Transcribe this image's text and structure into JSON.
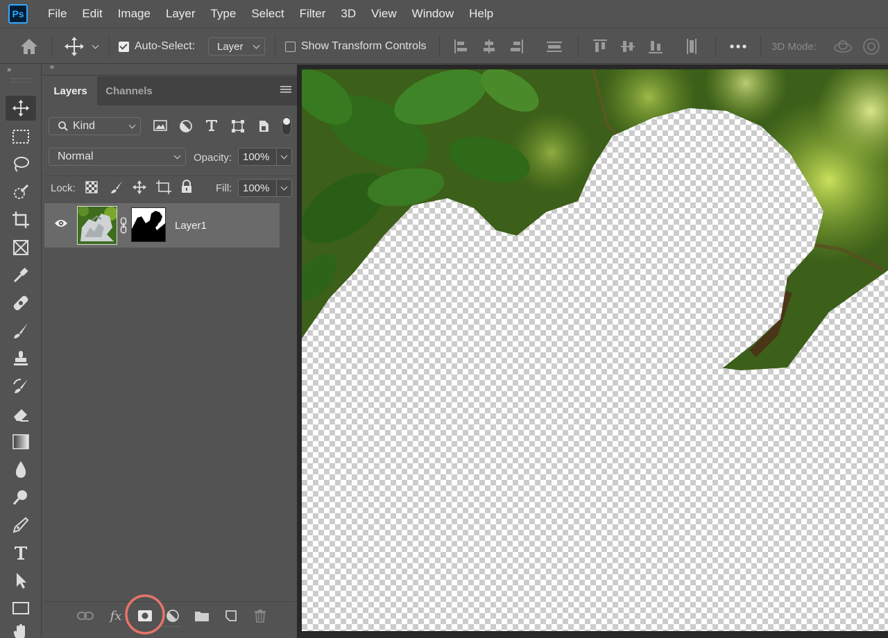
{
  "app": {
    "logo_text": "Ps"
  },
  "menu": [
    "File",
    "Edit",
    "Image",
    "Layer",
    "Type",
    "Select",
    "Filter",
    "3D",
    "View",
    "Window",
    "Help"
  ],
  "options_bar": {
    "auto_select_label": "Auto-Select:",
    "auto_select_checked": true,
    "auto_select_target": "Layer",
    "show_transform_label": "Show Transform Controls",
    "show_transform_checked": false,
    "mode_3d_label": "3D Mode:"
  },
  "panel": {
    "tabs": [
      "Layers",
      "Channels"
    ],
    "active_tab": "Layers",
    "filter": {
      "label": "Kind"
    },
    "blend_mode": "Normal",
    "opacity_label": "Opacity:",
    "opacity_value": "100%",
    "lock_label": "Lock:",
    "fill_label": "Fill:",
    "fill_value": "100%",
    "layers": [
      {
        "name": "Layer1",
        "visible": true,
        "has_mask": true
      }
    ]
  },
  "tools": [
    "move-tool",
    "marquee-tool",
    "lasso-tool",
    "quick-selection-tool",
    "crop-tool",
    "frame-tool",
    "eyedropper-tool",
    "healing-brush-tool",
    "brush-tool",
    "clone-stamp-tool",
    "history-brush-tool",
    "eraser-tool",
    "gradient-tool",
    "blur-tool",
    "dodge-tool",
    "pen-tool",
    "type-tool",
    "path-selection-tool",
    "rectangle-tool",
    "hand-tool"
  ],
  "colors": {
    "ui_bg": "#535353",
    "highlight_circle": "#e8746a",
    "ps_blue": "#31a8ff"
  }
}
